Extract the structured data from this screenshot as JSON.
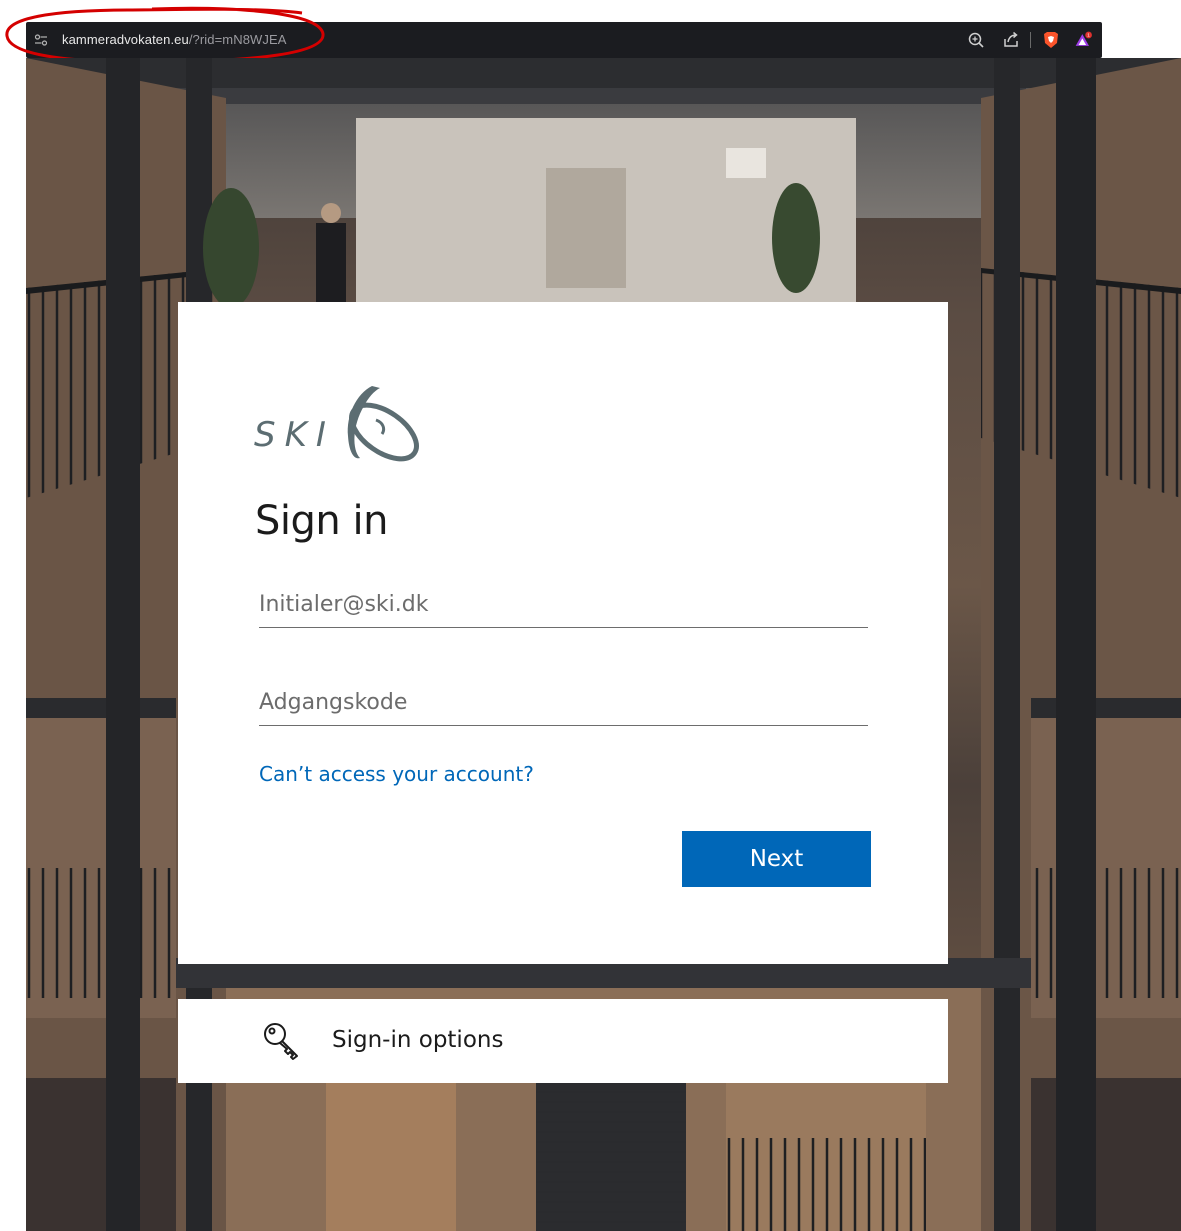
{
  "browser": {
    "url_host": "kammeradvokaten.eu",
    "url_path": "/?rid=mN8WJEA",
    "icons": [
      "site-info-icon",
      "zoom-icon",
      "share-icon",
      "brave-shield-icon",
      "brave-rewards-icon"
    ],
    "rewards_badge": "1"
  },
  "card": {
    "logo_text": "SKI",
    "title": "Sign in",
    "email_placeholder": "Initialer@ski.dk",
    "password_placeholder": "Adgangskode",
    "cant_access_link": "Can’t access your account?",
    "next_label": "Next"
  },
  "options": {
    "label": "Sign-in options",
    "icon": "key-icon"
  },
  "colors": {
    "accent": "#0067b8",
    "annotation": "#d40000",
    "logo": "#5c6d72"
  }
}
